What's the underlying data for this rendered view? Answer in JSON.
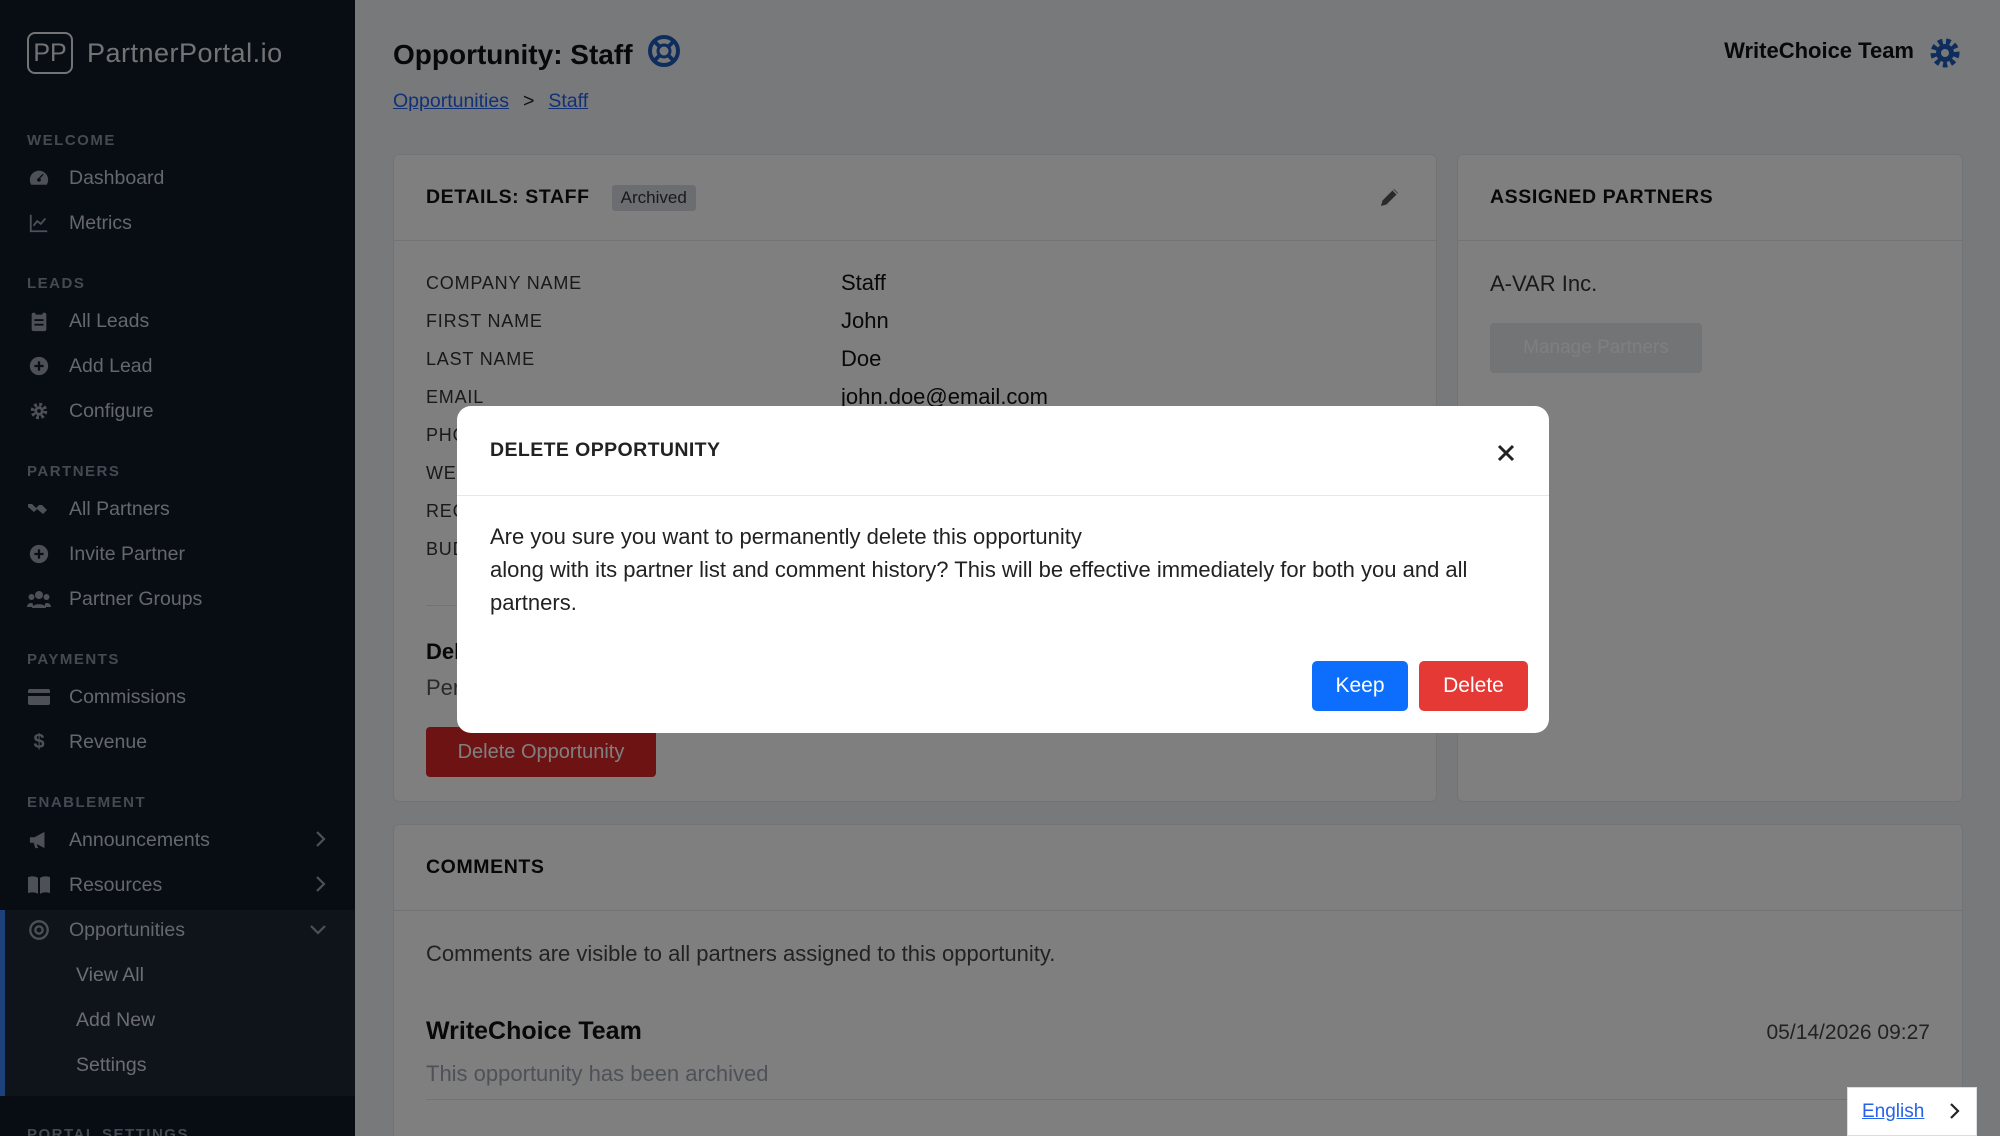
{
  "brand": {
    "mark": "PP",
    "name": "PartnerPortal.io"
  },
  "sidebar": {
    "sections": [
      {
        "label": "WELCOME",
        "items": [
          {
            "label": "Dashboard",
            "icon": "dashboard-icon"
          },
          {
            "label": "Metrics",
            "icon": "chart-line-icon"
          }
        ]
      },
      {
        "label": "LEADS",
        "items": [
          {
            "label": "All Leads",
            "icon": "clipboard-icon"
          },
          {
            "label": "Add Lead",
            "icon": "plus-circle-icon"
          },
          {
            "label": "Configure",
            "icon": "gear-icon"
          }
        ]
      },
      {
        "label": "PARTNERS",
        "items": [
          {
            "label": "All Partners",
            "icon": "handshake-icon"
          },
          {
            "label": "Invite Partner",
            "icon": "plus-circle-icon"
          },
          {
            "label": "Partner Groups",
            "icon": "users-icon"
          }
        ]
      },
      {
        "label": "PAYMENTS",
        "items": [
          {
            "label": "Commissions",
            "icon": "credit-card-icon"
          },
          {
            "label": "Revenue",
            "icon": "dollar-icon"
          }
        ]
      },
      {
        "label": "ENABLEMENT",
        "items": [
          {
            "label": "Announcements",
            "icon": "megaphone-icon"
          },
          {
            "label": "Resources",
            "icon": "book-icon"
          },
          {
            "label": "Opportunities",
            "icon": "target-icon"
          }
        ]
      },
      {
        "label": "PORTAL SETTINGS"
      }
    ],
    "opportunities_sub": [
      "View All",
      "Add New",
      "Settings"
    ]
  },
  "header": {
    "title": "Opportunity: Staff",
    "user": "WriteChoice Team",
    "breadcrumb": [
      "Opportunities",
      "Staff"
    ],
    "breadcrumb_sep": ">"
  },
  "details": {
    "title": "DETAILS: STAFF",
    "status": "Archived",
    "fields": [
      {
        "label": "COMPANY NAME",
        "value": "Staff"
      },
      {
        "label": "FIRST NAME",
        "value": "John"
      },
      {
        "label": "LAST NAME",
        "value": "Doe"
      },
      {
        "label": "EMAIL",
        "value": "john.doe@email.com"
      },
      {
        "label": "PHO",
        "value": ""
      },
      {
        "label": "WEB",
        "value": ""
      },
      {
        "label": "REG",
        "value": ""
      },
      {
        "label": "BUD",
        "value": ""
      }
    ],
    "delete_heading": "Del",
    "delete_desc": "Per",
    "delete_button": "Delete Opportunity"
  },
  "partners": {
    "title": "ASSIGNED PARTNERS",
    "items": [
      "A-VAR Inc."
    ],
    "manage_button": "Manage Partners"
  },
  "comments": {
    "title": "COMMENTS",
    "note": "Comments are visible to all partners assigned to this opportunity.",
    "items": [
      {
        "author": "WriteChoice Team",
        "date": "05/14/2026 09:27",
        "text": "This opportunity has been archived"
      }
    ]
  },
  "modal": {
    "title": "DELETE OPPORTUNITY",
    "body_line1": "Are you sure you want to permanently delete this opportunity",
    "body_line2": "along with its partner list and comment history? This will be effective immediately for both you and all partners.",
    "keep_label": "Keep",
    "delete_label": "Delete",
    "keep_color": "#0d6efd",
    "delete_color": "#e53935"
  },
  "language": {
    "label": "English"
  }
}
